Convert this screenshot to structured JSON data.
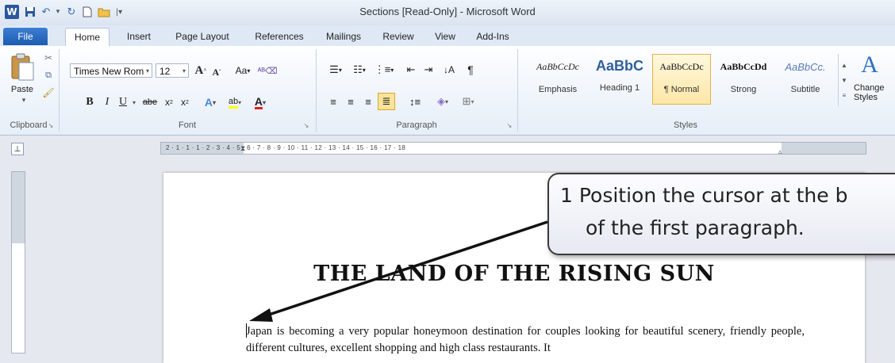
{
  "window": {
    "title": "Sections [Read-Only]  -  Microsoft Word",
    "app_icon_letter": "W"
  },
  "tabs": [
    "File",
    "Home",
    "Insert",
    "Page Layout",
    "References",
    "Mailings",
    "Review",
    "View",
    "Add-Ins"
  ],
  "clipboard": {
    "paste_label": "Paste",
    "group_label": "Clipboard"
  },
  "font": {
    "name": "Times New Rom",
    "size": "12",
    "group_label": "Font",
    "grow_glyph": "A",
    "shrink_glyph": "A",
    "case_glyph": "Aa"
  },
  "paragraph": {
    "group_label": "Paragraph"
  },
  "styles": {
    "group_label": "Styles",
    "items": [
      {
        "preview": "AaBbCcDc",
        "label": "Emphasis"
      },
      {
        "preview": "AaBbC",
        "label": "Heading 1"
      },
      {
        "preview": "AaBbCcDc",
        "label": "¶ Normal"
      },
      {
        "preview": "AaBbCcDd",
        "label": "Strong"
      },
      {
        "preview": "AaBbCc.",
        "label": "Subtitle"
      }
    ],
    "change_styles_label": "Change Styles"
  },
  "ruler": {
    "labels": "2 · 1 · 1 · 1 · 2 · 3 · 4 · 5 · 6 · 7 · 8 · 9 · 10 · 11 · 12 · 13 · 14 · 15 · 16 · 17 · 18"
  },
  "document": {
    "heading": "THE LAND OF THE RISING SUN",
    "body": "Japan is becoming a very popular honeymoon destination for couples looking for beautiful scenery, friendly people, different cultures, excellent shopping and high class restaurants. It"
  },
  "callout": {
    "line1": "1  Position the cursor at the b",
    "line2": "of the first paragraph."
  },
  "colors": {
    "accent": "#2b579a",
    "file_tab": "#1c5cb0",
    "ribbon_bg": "#e6eef8"
  }
}
